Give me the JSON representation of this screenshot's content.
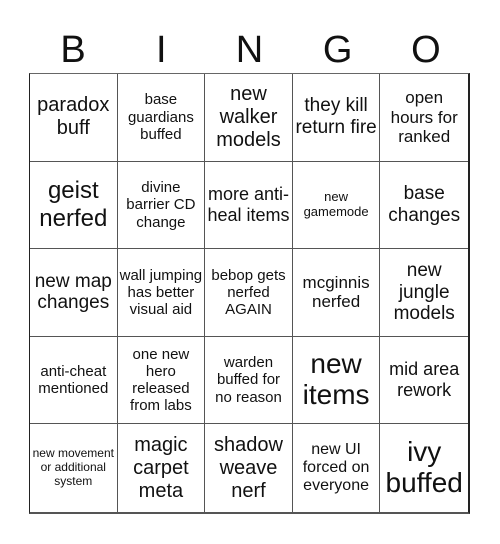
{
  "header": {
    "letters": [
      "B",
      "I",
      "N",
      "G",
      "O"
    ]
  },
  "card": {
    "cells": [
      "paradox buff",
      "base guardians buffed",
      "new walker models",
      "they kill return fire",
      "open hours for ranked",
      "geist nerfed",
      "divine barrier CD change",
      "more anti-heal items",
      "new gamemode",
      "base changes",
      "new map changes",
      "wall jumping has better visual aid",
      "bebop gets nerfed AGAIN",
      "mcginnis nerfed",
      "new jungle models",
      "anti-cheat mentioned",
      "one new hero released from labs",
      "warden buffed for no reason",
      "new items",
      "mid area rework",
      "new movement or additional system",
      "magic carpet meta",
      "shadow weave nerf",
      "new UI forced on everyone",
      "ivy buffed"
    ]
  }
}
